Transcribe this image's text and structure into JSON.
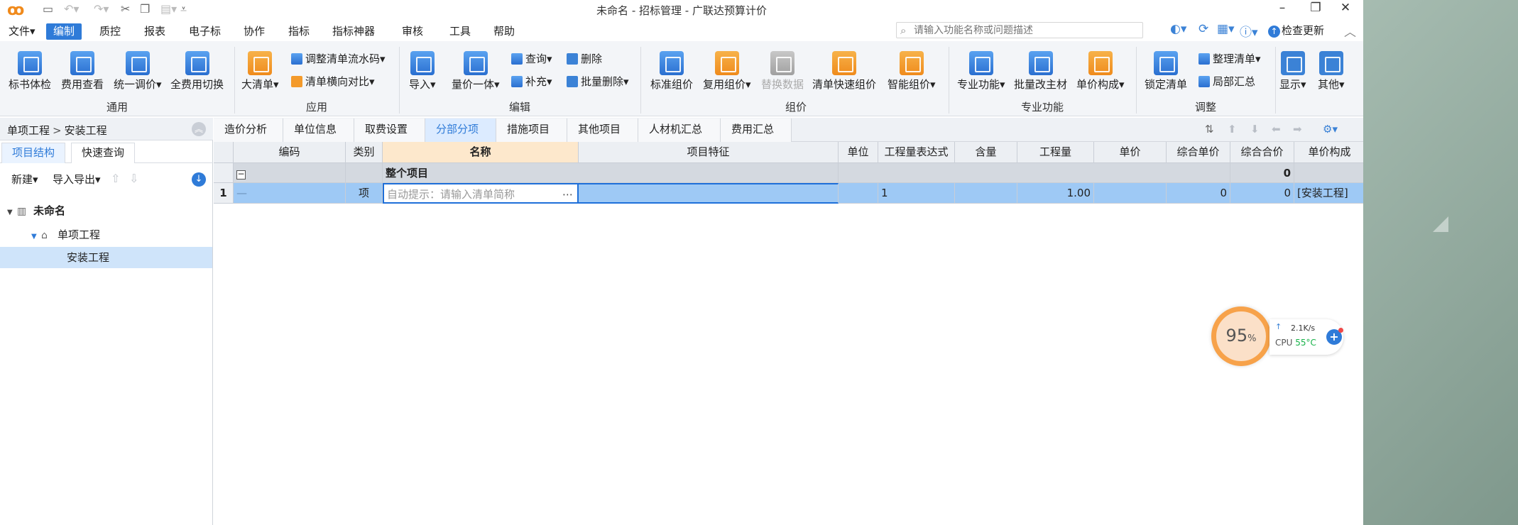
{
  "app": {
    "window_title": "未命名 - 招标管理 - 广联达预算计价"
  },
  "menubar": {
    "items": [
      "文件",
      "编制",
      "质控",
      "报表",
      "电子标",
      "协作",
      "指标",
      "指标神器",
      "审核",
      "工具",
      "帮助"
    ],
    "active": "编制",
    "search_placeholder": "请输入功能名称或问题描述",
    "check_update": "检查更新"
  },
  "ribbon": {
    "groups": [
      {
        "label": "通用",
        "buttons": [
          "标书体检",
          "费用查看",
          "统一调价",
          "全费用切换"
        ]
      },
      {
        "label": "应用",
        "buttons": [
          "大清单",
          "调整清单流水码",
          "清单横向对比"
        ]
      },
      {
        "label": "编辑",
        "buttons": [
          "导入",
          "量价一体",
          "查询",
          "删除",
          "补充",
          "批量删除"
        ]
      },
      {
        "label": "组价",
        "buttons": [
          "标准组价",
          "复用组价",
          "替换数据",
          "清单快速组价",
          "智能组价"
        ]
      },
      {
        "label": "专业功能",
        "buttons": [
          "专业功能",
          "批量改主材",
          "单价构成"
        ]
      },
      {
        "label": "调整",
        "buttons": [
          "锁定清单",
          "整理清单",
          "局部汇总"
        ]
      },
      {
        "label": "",
        "buttons": [
          "显示",
          "其他"
        ]
      }
    ]
  },
  "leftpanel": {
    "breadcrumb": [
      "单项工程",
      "安装工程"
    ],
    "tabs": [
      "项目结构",
      "快速查询"
    ],
    "tools": [
      "新建",
      "导入导出"
    ],
    "tree": [
      {
        "label": "未命名",
        "level": 0
      },
      {
        "label": "单项工程",
        "level": 1
      },
      {
        "label": "安装工程",
        "level": 2,
        "selected": true
      }
    ]
  },
  "main": {
    "tabs": [
      "造价分析",
      "单位信息",
      "取费设置",
      "分部分项",
      "措施项目",
      "其他项目",
      "人材机汇总",
      "费用汇总"
    ],
    "active_tab": "分部分项",
    "columns": [
      "编码",
      "类别",
      "名称",
      "项目特征",
      "单位",
      "工程量表达式",
      "含量",
      "工程量",
      "单价",
      "综合单价",
      "综合合价",
      "单价构成"
    ],
    "group_row": {
      "name": "整个项目",
      "total": "0"
    },
    "rows": [
      {
        "num": "1",
        "code": "—",
        "type": "项",
        "name_placeholder": "自动提示：请输入清单简称",
        "expr": "1",
        "qty": "1.00",
        "unit_price": "0",
        "total": "0",
        "composition": "[安装工程]"
      }
    ]
  },
  "widget": {
    "percent": "95",
    "percent_sign": "%",
    "speed": "2.1K/s",
    "cpu_label": "CPU",
    "cpu_temp": "55°C"
  }
}
